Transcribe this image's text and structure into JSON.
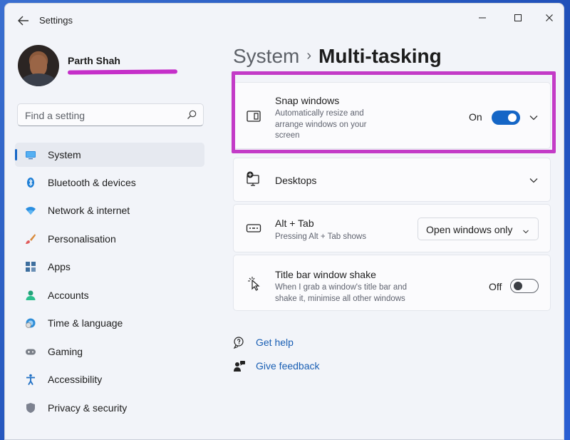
{
  "window": {
    "title": "Settings"
  },
  "user": {
    "name": "Parth Shah"
  },
  "search": {
    "placeholder": "Find a setting"
  },
  "sidebar": {
    "items": [
      {
        "label": "System",
        "icon": "monitor-icon"
      },
      {
        "label": "Bluetooth & devices",
        "icon": "bluetooth-icon"
      },
      {
        "label": "Network & internet",
        "icon": "wifi-icon"
      },
      {
        "label": "Personalisation",
        "icon": "brush-icon"
      },
      {
        "label": "Apps",
        "icon": "apps-icon"
      },
      {
        "label": "Accounts",
        "icon": "person-icon"
      },
      {
        "label": "Time & language",
        "icon": "globe-clock-icon"
      },
      {
        "label": "Gaming",
        "icon": "gamepad-icon"
      },
      {
        "label": "Accessibility",
        "icon": "accessibility-icon"
      },
      {
        "label": "Privacy & security",
        "icon": "shield-icon"
      }
    ],
    "selected": "System"
  },
  "breadcrumb": {
    "parent": "System",
    "separator": "›",
    "current": "Multi-tasking"
  },
  "settings": {
    "snap": {
      "title": "Snap windows",
      "description": "Automatically resize and arrange windows on your screen",
      "state_label": "On",
      "enabled": true
    },
    "desktops": {
      "title": "Desktops"
    },
    "alttab": {
      "title": "Alt + Tab",
      "description": "Pressing Alt + Tab shows",
      "selected_option": "Open windows only"
    },
    "shake": {
      "title": "Title bar window shake",
      "description": "When I grab a window's title bar and shake it, minimise all other windows",
      "state_label": "Off",
      "enabled": false
    }
  },
  "help": {
    "get_help": "Get help",
    "give_feedback": "Give feedback"
  },
  "colors": {
    "accent": "#1566c6",
    "highlight": "#c33bc7",
    "link": "#1a5fb4"
  }
}
